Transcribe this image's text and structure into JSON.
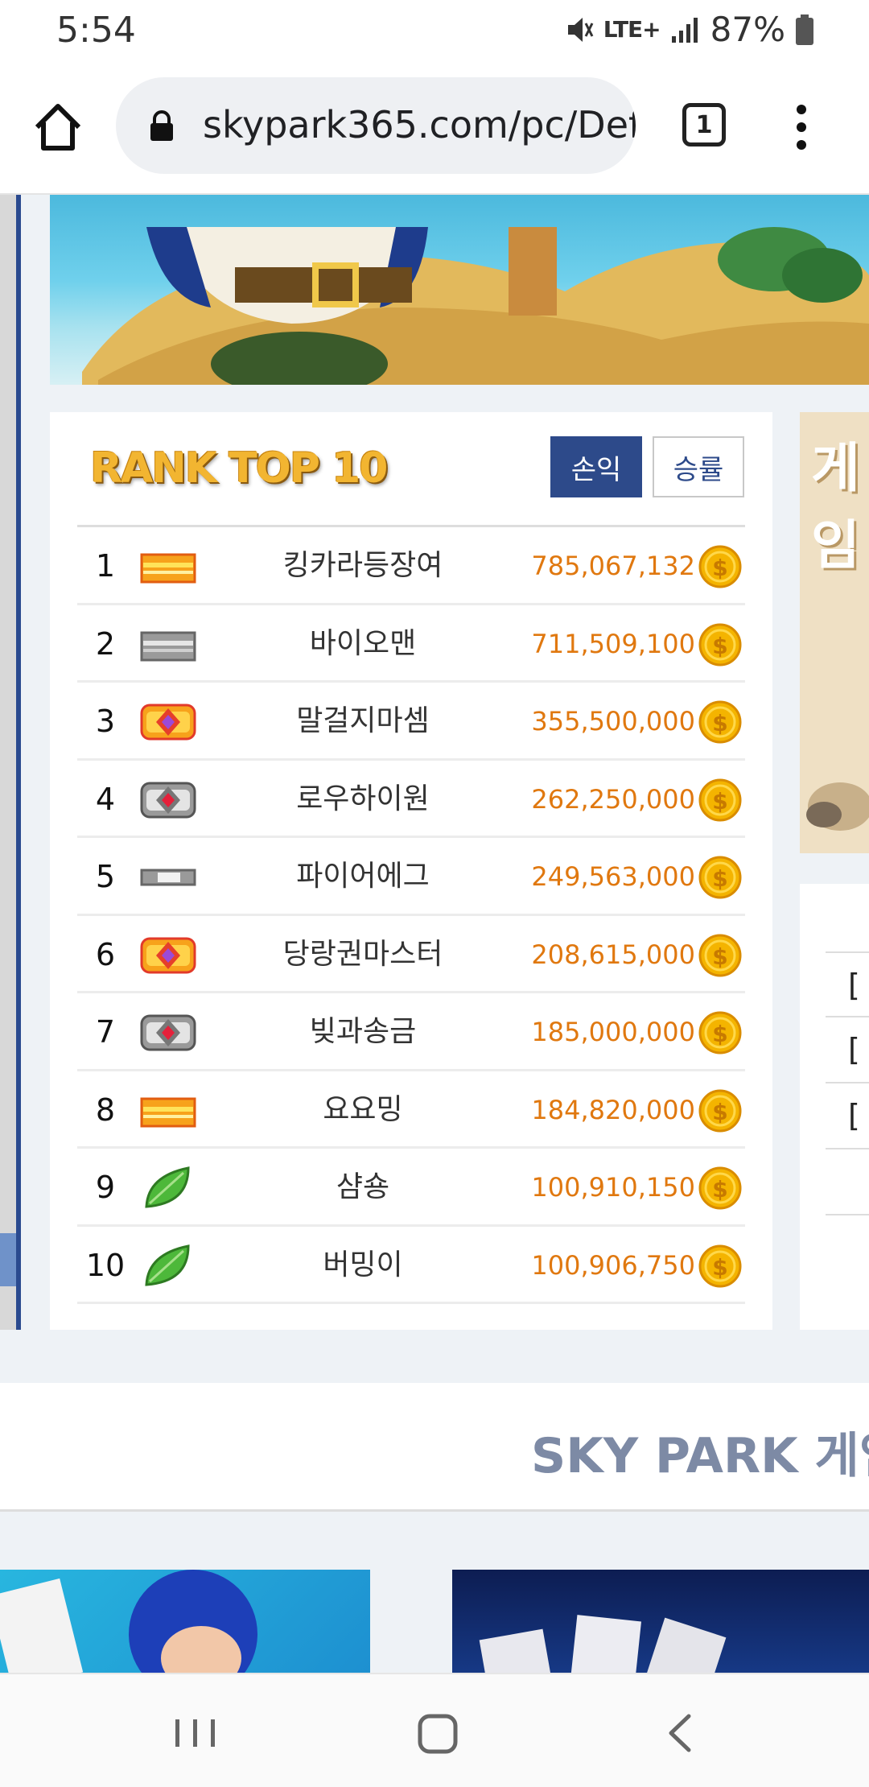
{
  "status_bar": {
    "time": "5:54",
    "network": "LTE+",
    "battery": "87%"
  },
  "browser": {
    "url": "skypark365.com/pc/Def",
    "tab_count": "1"
  },
  "rank": {
    "title": "RANK TOP 10",
    "tabs": [
      {
        "label": "손익",
        "active": true
      },
      {
        "label": "승률",
        "active": false
      }
    ],
    "rows": [
      {
        "rank": "1",
        "badge": "gold-bar",
        "name": "킹카라등장여",
        "money": "785,067,132"
      },
      {
        "rank": "2",
        "badge": "silver-bar",
        "name": "바이오맨",
        "money": "711,509,100"
      },
      {
        "rank": "3",
        "badge": "gold-gem",
        "name": "말걸지마셈",
        "money": "355,500,000"
      },
      {
        "rank": "4",
        "badge": "silver-gem",
        "name": "로우하이원",
        "money": "262,250,000"
      },
      {
        "rank": "5",
        "badge": "silver-thin-bar",
        "name": "파이어에그",
        "money": "249,563,000"
      },
      {
        "rank": "6",
        "badge": "gold-gem",
        "name": "당랑권마스터",
        "money": "208,615,000"
      },
      {
        "rank": "7",
        "badge": "silver-gem",
        "name": "빚과송금",
        "money": "185,000,000"
      },
      {
        "rank": "8",
        "badge": "gold-bar",
        "name": "요요밍",
        "money": "184,820,000"
      },
      {
        "rank": "9",
        "badge": "leaf",
        "name": "샴숑",
        "money": "100,910,150"
      },
      {
        "rank": "10",
        "badge": "leaf",
        "name": "버밍이",
        "money": "100,906,750"
      }
    ]
  },
  "side_panel": {
    "header": "게임",
    "rows": [
      "[",
      "[",
      "["
    ]
  },
  "section": {
    "title": "SKY PARK 게임"
  },
  "colors": {
    "accent": "#2d4a8a",
    "money": "#e0780f",
    "coin": "#f4b400"
  }
}
